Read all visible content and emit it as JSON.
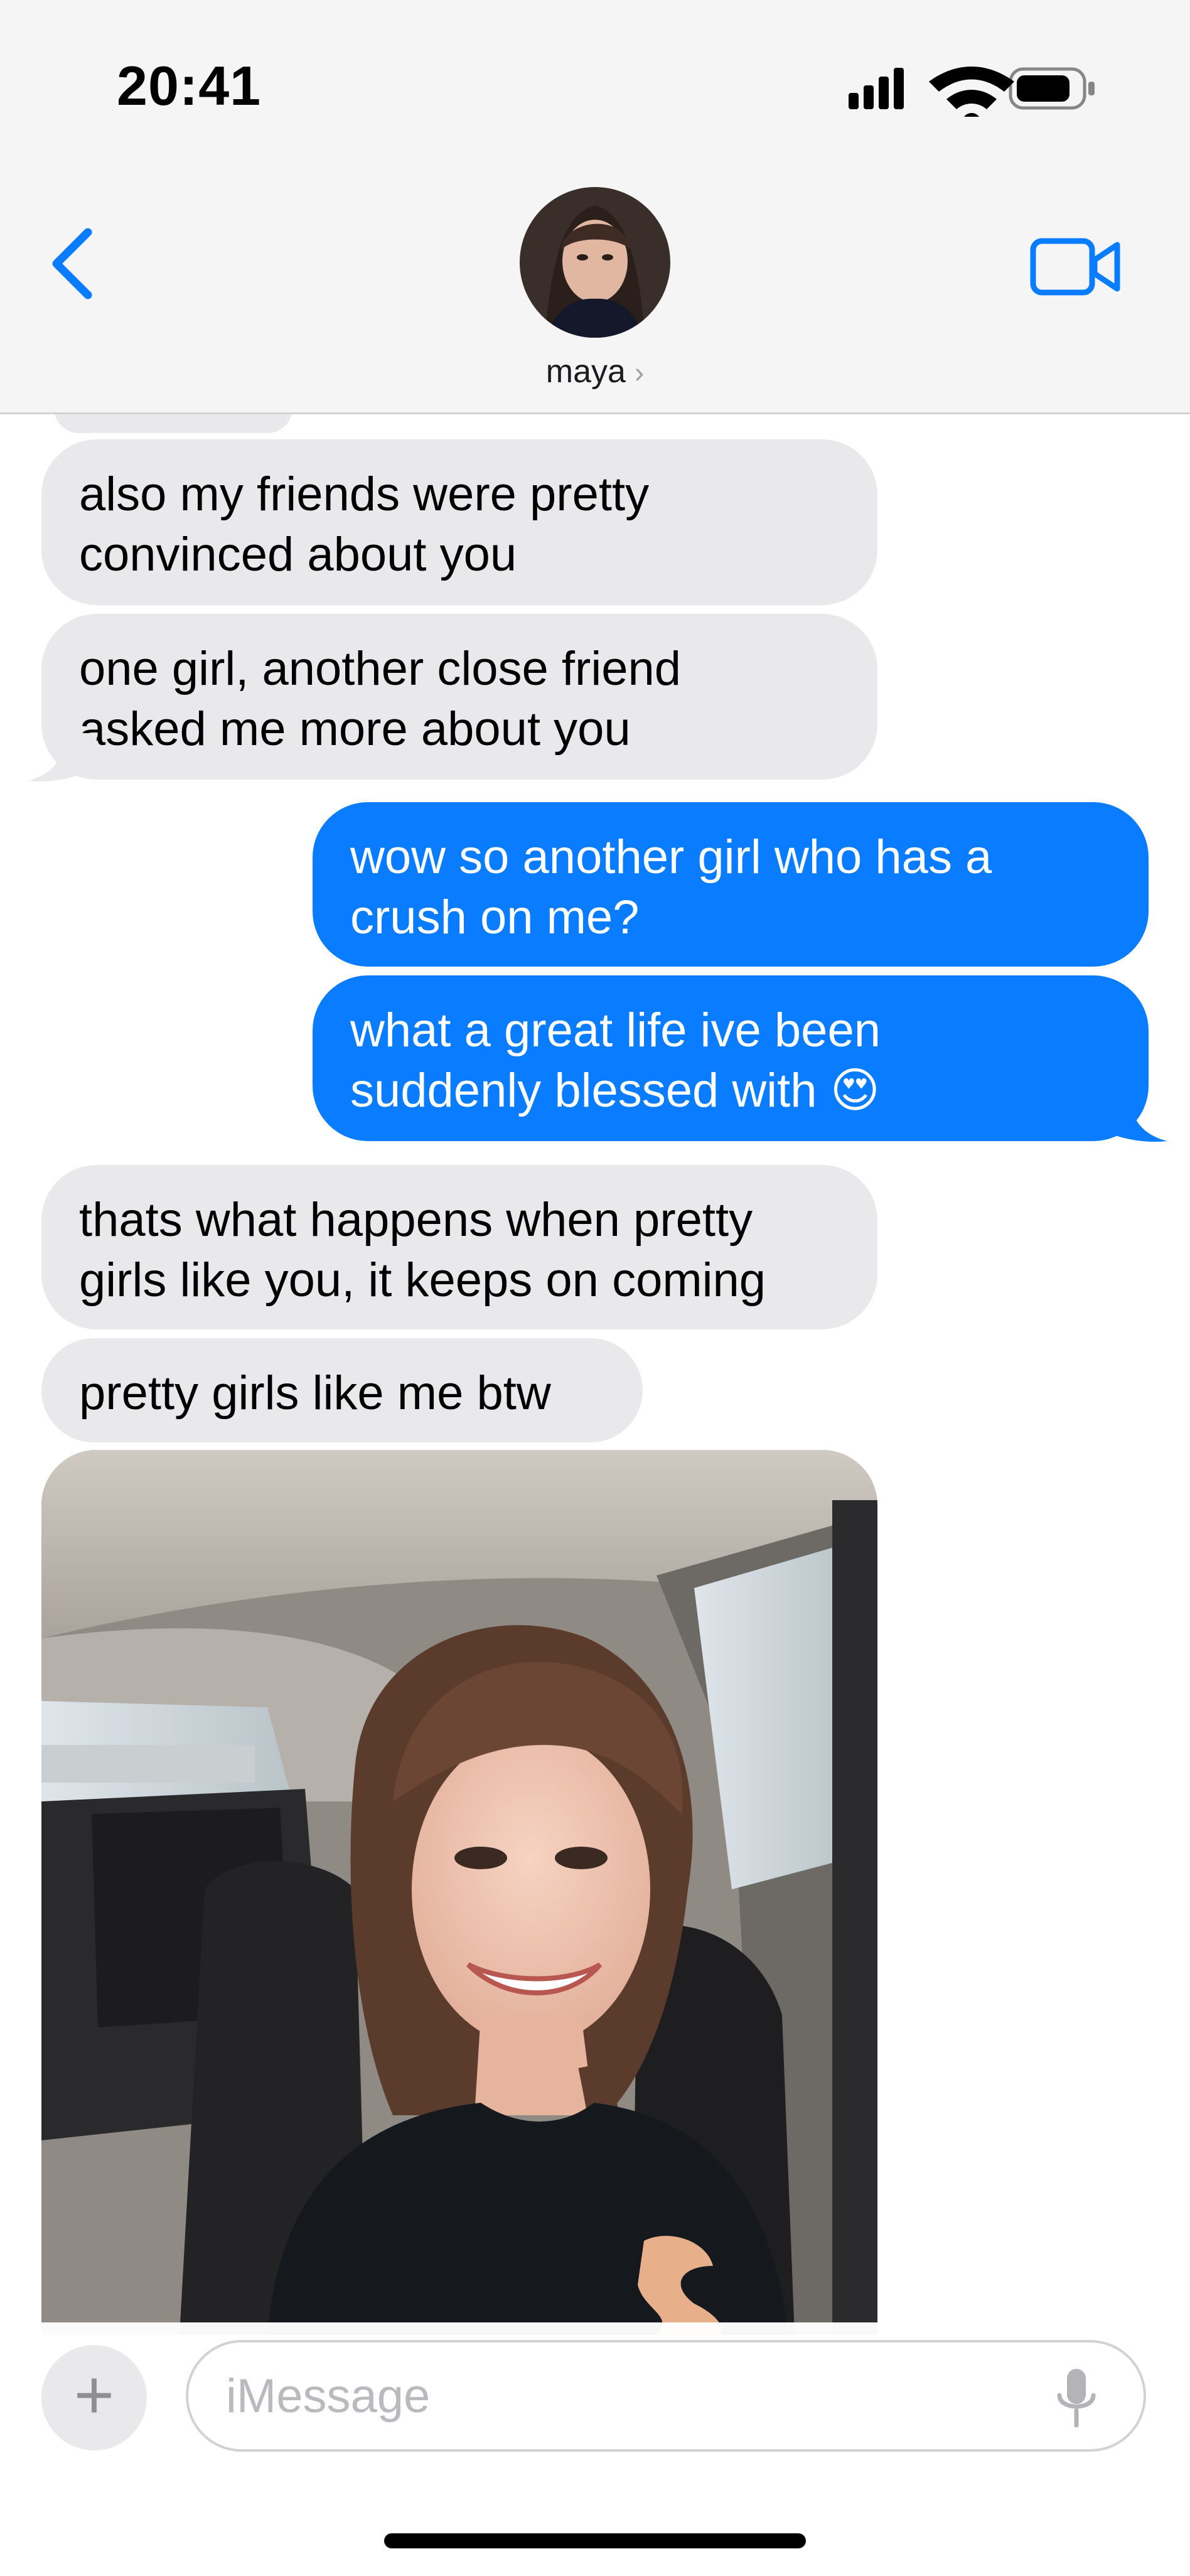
{
  "status_bar": {
    "time": "20:41",
    "icons": [
      "cellular-signal-icon",
      "wifi-icon",
      "battery-icon"
    ]
  },
  "header": {
    "contact_name": "maya",
    "chevron": "›",
    "icons": [
      "back-chevron-icon",
      "video-call-icon"
    ]
  },
  "messages": [
    {
      "sender": "contact",
      "text": "also my friends were pretty\nconvinced about you"
    },
    {
      "sender": "contact",
      "text": "one girl, another close friend\nasked me more about you"
    },
    {
      "sender": "me",
      "text": "wow so another girl who has a\ncrush on me?"
    },
    {
      "sender": "me",
      "text": "what a great life ive been\nsuddenly blessed with 😍"
    },
    {
      "sender": "contact",
      "text": "thats what happens when pretty\ngirls like you, it keeps on coming"
    },
    {
      "sender": "contact",
      "text": "pretty girls like me btw"
    },
    {
      "sender": "contact",
      "type": "photo",
      "icon": "photo-attachment"
    }
  ],
  "composer": {
    "plus_label": "+",
    "placeholder": "iMessage",
    "icons": [
      "microphone-icon"
    ]
  },
  "colors": {
    "incoming_bubble": "#e9e9eb",
    "outgoing_bubble": "#0a7cff",
    "accent": "#0a7cff"
  }
}
